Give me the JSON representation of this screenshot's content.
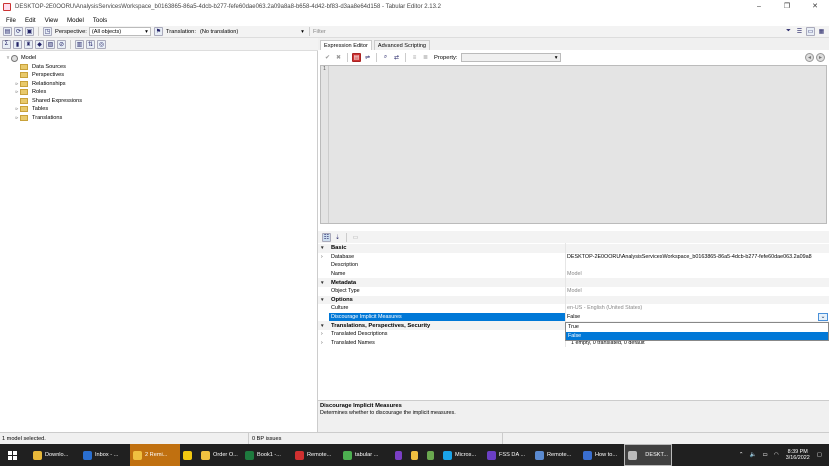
{
  "window": {
    "title": "DESKTOP-2E0OORU\\AnalysisServicesWorkspace_b0163865-86a5-4dcb-b277-fefe60dae063.2a09a8a8-b658-4d42-bf83-d3aa8e64d158 - Tabular Editor 2.13.2",
    "minimize": "–",
    "maximize": "❐",
    "close": "✕"
  },
  "menu": [
    "File",
    "Edit",
    "View",
    "Model",
    "Tools"
  ],
  "toolbar1": {
    "perspective_label": "Perspective:",
    "perspective_value": "(All objects)",
    "translation_label": "Translation:",
    "translation_value": "(No translation)",
    "filter_placeholder": "Filter"
  },
  "tree": {
    "root": "Model",
    "items": [
      "Data Sources",
      "Perspectives",
      "Relationships",
      "Roles",
      "Shared Expressions",
      "Tables",
      "Translations"
    ]
  },
  "tabs": [
    "Expression Editor",
    "Advanced Scripting"
  ],
  "expr": {
    "property_label": "Property:",
    "line_number": "1"
  },
  "props": {
    "cat_basic": "Basic",
    "database_name": "Database",
    "database_val": "DESKTOP-2E0OORU\\AnalysisServicesWorkspace_b0163865-86a5-4dcb-b277-fefe60dae063.2a09a8",
    "description_name": "Description",
    "name_name": "Name",
    "name_val": "Model",
    "cat_metadata": "Metadata",
    "objtype_name": "Object Type",
    "objtype_val": "Model",
    "cat_options": "Options",
    "culture_name": "Culture",
    "culture_val": "en-US - English (United States)",
    "discourage_name": "Discourage Implicit Measures",
    "discourage_val": "False",
    "cat_translations": "Translations, Perspectives, Security",
    "tdesc_name": "Translated Descriptions",
    "tnames_name": "Translated Names",
    "tnames_val": "1 empty, 0 translated, 0 default"
  },
  "dropdown": [
    "True",
    "False"
  ],
  "desc": {
    "title": "Discourage Implicit Measures",
    "text": "Determines whether to discourage the implicit measures."
  },
  "status": {
    "left": "1 model selected.",
    "mid": "0 BP issues"
  },
  "taskbar": {
    "items": [
      {
        "label": "Downlo...",
        "color": "#e8b83a"
      },
      {
        "label": "Inbox - ...",
        "color": "#2a6fd0"
      },
      {
        "label": "2 Remi...",
        "color": "#f0c040"
      },
      {
        "label": "",
        "color": "#f2c811"
      },
      {
        "label": "Order O...",
        "color": "#f0c040"
      },
      {
        "label": "Book1 -...",
        "color": "#1e7a3e"
      },
      {
        "label": "Remote...",
        "color": "#d03030"
      },
      {
        "label": "tabular ...",
        "color": "#4caf50"
      },
      {
        "label": "",
        "color": "#7b3fc4"
      },
      {
        "label": "",
        "color": "#f0c040"
      },
      {
        "label": "",
        "color": "#6aa84f"
      },
      {
        "label": "Micros...",
        "color": "#1aa3e8"
      },
      {
        "label": "FSS DA ...",
        "color": "#6b3fc4"
      },
      {
        "label": "Remote...",
        "color": "#5a8ad0"
      },
      {
        "label": "How to...",
        "color": "#3a6fd0"
      },
      {
        "label": "DESKT...",
        "color": "#bbbbbb"
      }
    ],
    "time": "8:39 PM",
    "date": "3/16/2022"
  }
}
